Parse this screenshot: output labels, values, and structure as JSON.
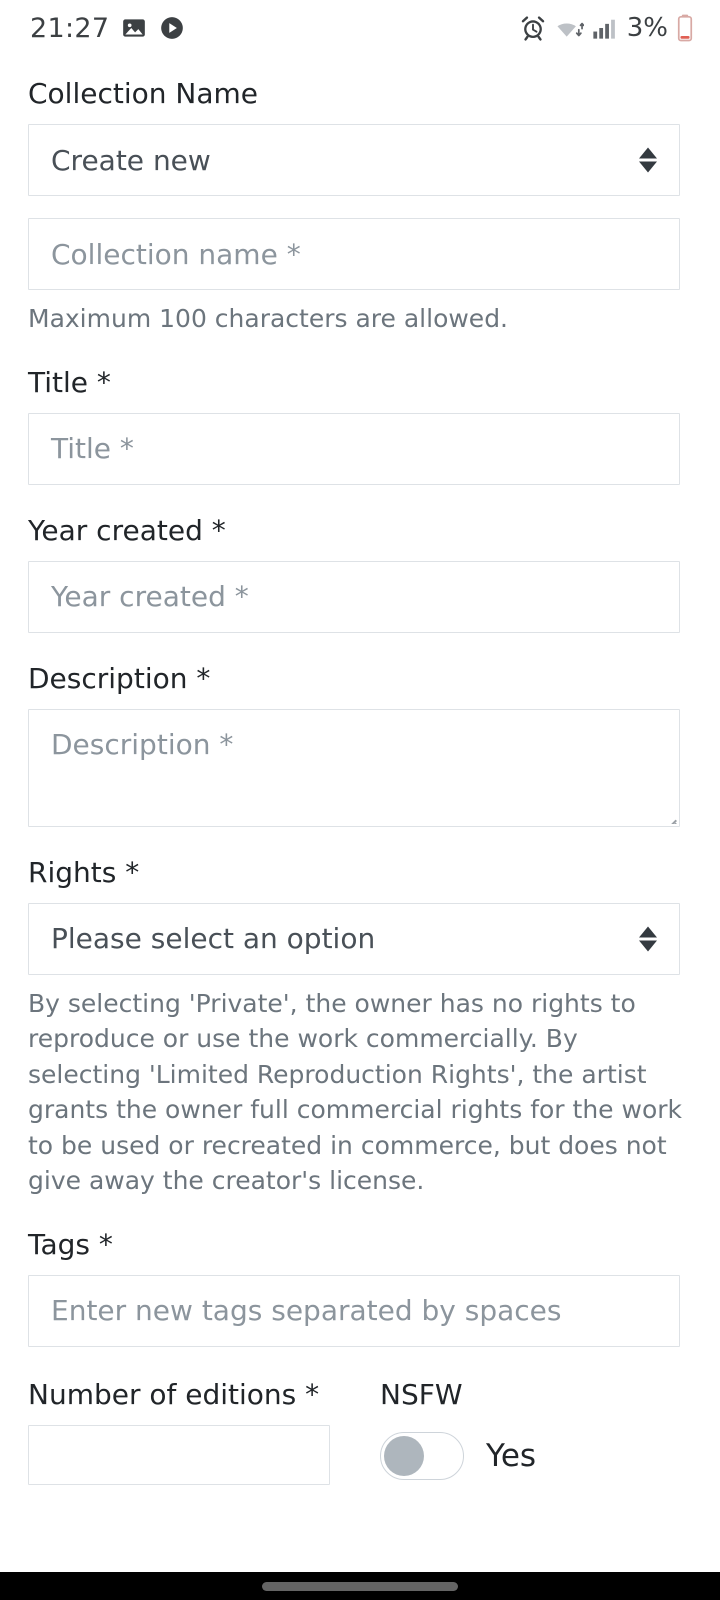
{
  "status_bar": {
    "time": "21:27",
    "battery_percent": "3%",
    "left_icons": [
      "image-icon",
      "play-circle-icon"
    ],
    "right_icons": [
      "alarm-icon",
      "wifi-icon",
      "signal-icon",
      "battery-icon"
    ],
    "colors": {
      "text": "#3c4043",
      "battery_low": "#e06055"
    }
  },
  "form": {
    "collection": {
      "label": "Collection Name",
      "select_value": "Create new",
      "name_placeholder": "Collection name *",
      "help": "Maximum 100 characters are allowed."
    },
    "title": {
      "label": "Title *",
      "placeholder": "Title *"
    },
    "year_created": {
      "label": "Year created *",
      "placeholder": "Year created *"
    },
    "description": {
      "label": "Description *",
      "placeholder": "Description *"
    },
    "rights": {
      "label": "Rights *",
      "select_value": "Please select an option",
      "help": "By selecting 'Private', the owner has no rights to reproduce or use the work commercially. By selecting 'Limited Reproduction Rights', the artist grants the owner full commercial rights for the work to be used or recreated in commerce, but does not give away the creator's license."
    },
    "tags": {
      "label": "Tags *",
      "placeholder": "Enter new tags separated by spaces"
    },
    "editions": {
      "label": "Number of editions *",
      "value": ""
    },
    "nsfw": {
      "label": "NSFW",
      "toggle_state": "off",
      "toggle_text": "Yes"
    }
  },
  "theme": {
    "border": "#dee2e6",
    "label_text": "#212529",
    "help_text": "#6c757d",
    "placeholder_text": "#8c959d",
    "background": "#ffffff",
    "nav_bar": "#000000"
  }
}
